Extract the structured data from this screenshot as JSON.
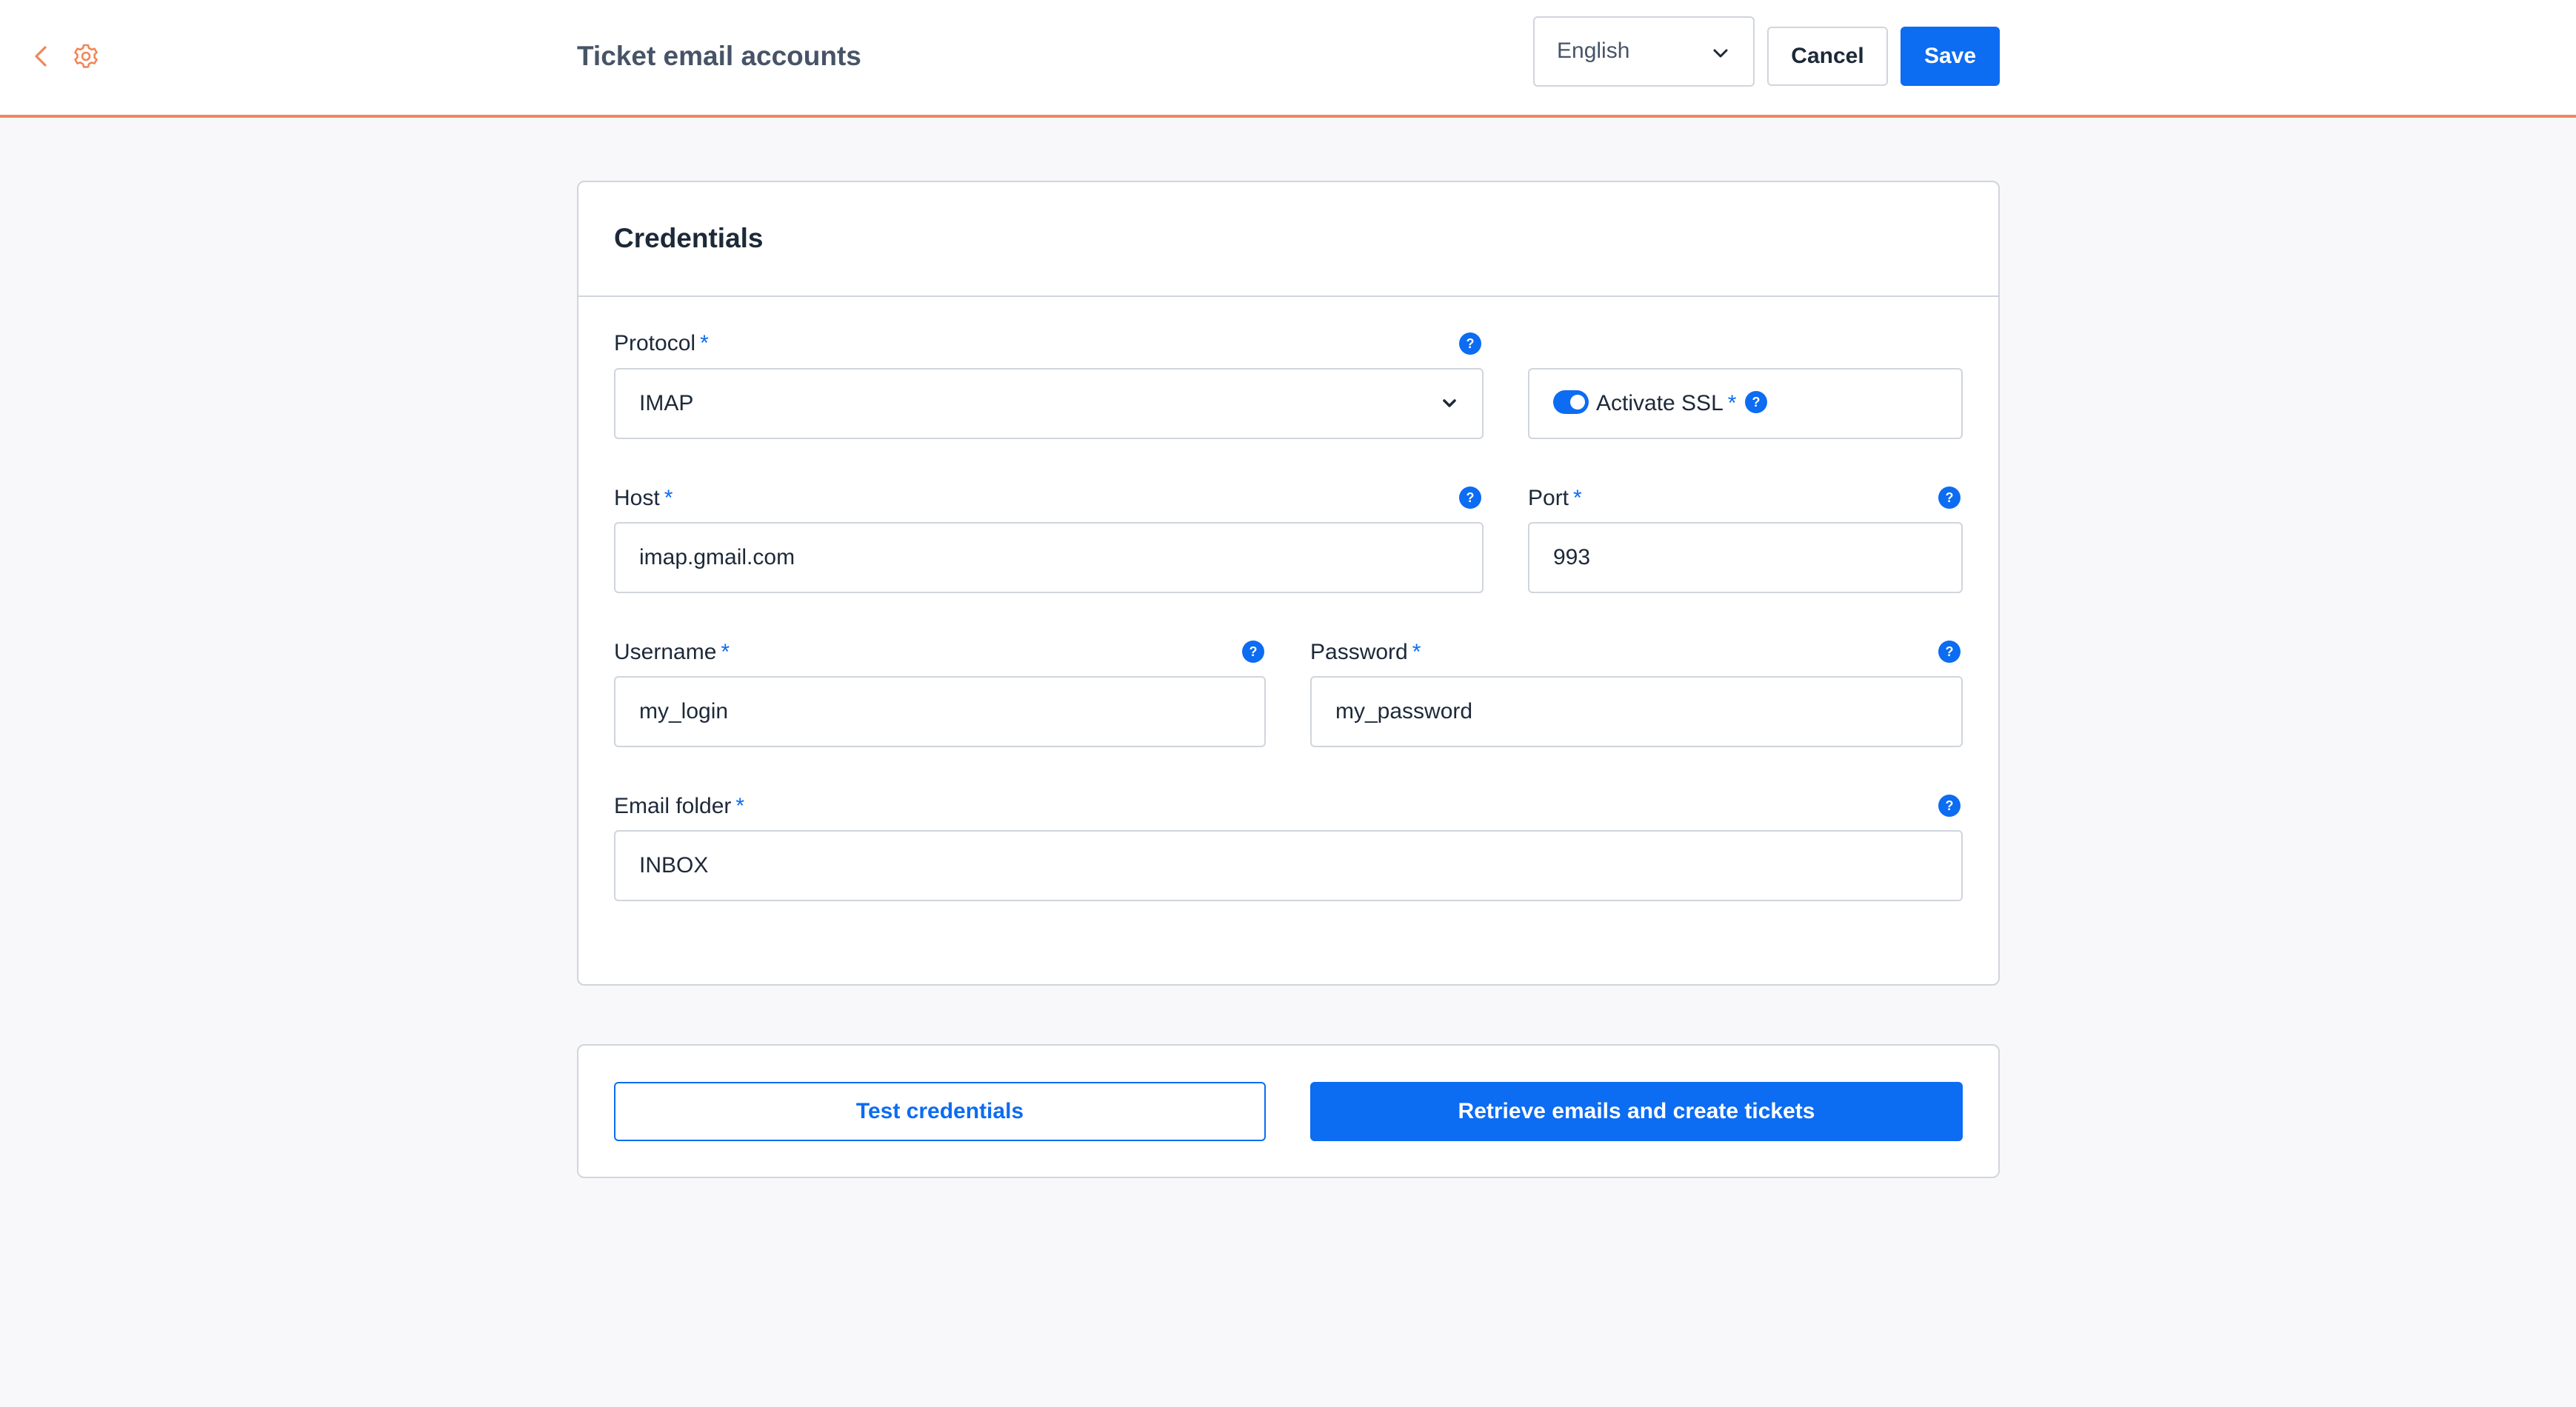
{
  "header": {
    "title": "Ticket email accounts",
    "language": "English",
    "cancel_label": "Cancel",
    "save_label": "Save",
    "accent_color": "#f0875a"
  },
  "credentials": {
    "title": "Credentials",
    "required_mark": "*",
    "protocol": {
      "label": "Protocol",
      "value": "IMAP"
    },
    "ssl": {
      "label": "Activate SSL",
      "enabled": true
    },
    "host": {
      "label": "Host",
      "value": "imap.gmail.com"
    },
    "port": {
      "label": "Port",
      "value": "993"
    },
    "username": {
      "label": "Username",
      "value": "my_login"
    },
    "password": {
      "label": "Password",
      "value": "my_password"
    },
    "email_folder": {
      "label": "Email folder",
      "value": "INBOX"
    }
  },
  "actions": {
    "test_label": "Test credentials",
    "retrieve_label": "Retrieve emails and create tickets"
  },
  "colors": {
    "primary": "#0c6cf2",
    "border": "#d0d5dd",
    "background": "#f8f8fa"
  },
  "icons": [
    "chevron-left-icon",
    "gear-icon",
    "chevron-down-icon",
    "help-icon",
    "toggle-switch"
  ]
}
